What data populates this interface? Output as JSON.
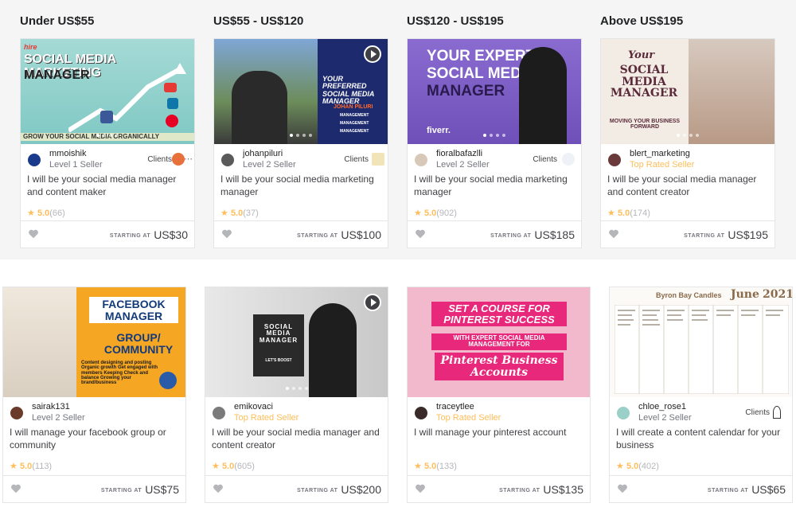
{
  "columns": [
    "Under US$55",
    "US$55 - US$120",
    "US$120 - US$195",
    "Above US$195"
  ],
  "starting_label": "STARTING AT",
  "cards": [
    {
      "seller": "mmoishik",
      "level": "Level 1 Seller",
      "clients": "Clients",
      "title": "I will be your social media manager and content maker",
      "rating": "5.0",
      "count": "(66)",
      "price": "US$30",
      "thumb_text": {
        "a": "hire",
        "b": "SOCIAL MEDIA MARKETING",
        "c": "MANAGER",
        "d": "GROW YOUR SOCIAL MEDIA ORGANICALLY"
      }
    },
    {
      "seller": "johanpiluri",
      "level": "Level 2 Seller",
      "clients": "Clients",
      "title": "I will be your social media marketing manager",
      "rating": "5.0",
      "count": "(37)",
      "price": "US$100",
      "thumb_text": {
        "a": "YOUR PREFERRED SOCIAL MEDIA MANAGER",
        "b": "JOHAN PILURI",
        "c": "MANAGEMENT",
        "d": "MANAGEMENT",
        "e": "MANAGEMENT"
      }
    },
    {
      "seller": "fioralbafazlli",
      "level": "Level 2 Seller",
      "clients": "Clients",
      "title": "I will be your social media marketing manager",
      "rating": "5.0",
      "count": "(902)",
      "price": "US$185",
      "thumb_text": {
        "a": "YOUR EXPERT",
        "b": "SOCIAL MEDIA",
        "c": "MANAGER",
        "d": "fiverr."
      }
    },
    {
      "seller": "blert_marketing",
      "level": "Top Rated Seller",
      "title": "I will be your social media manager and content creator",
      "rating": "5.0",
      "count": "(174)",
      "price": "US$195",
      "thumb_text": {
        "a": "Your",
        "b": "SOCIAL MEDIA MANAGER",
        "c": "MOVING YOUR BUSINESS FORWARD"
      }
    },
    {
      "seller": "sairak131",
      "level": "Level 2 Seller",
      "title": "I will manage your facebook group or community",
      "rating": "5.0",
      "count": "(113)",
      "price": "US$75",
      "thumb_text": {
        "a": "FACEBOOK MANAGER",
        "b": "GROUP/ COMMUNITY",
        "c": "Content designing and posting Organic growth Get engaged with members Keeping Check and balance Growing your brand/business"
      }
    },
    {
      "seller": "emikovaci",
      "level": "Top Rated Seller",
      "title": "I will be your social media manager and content creator",
      "rating": "5.0",
      "count": "(605)",
      "price": "US$200",
      "thumb_text": {
        "a": "SOCIAL MEDIA MANAGER",
        "b": "LET'S BOOST"
      }
    },
    {
      "seller": "traceytlee",
      "level": "Top Rated Seller",
      "title": "I will manage your pinterest account",
      "rating": "5.0",
      "count": "(133)",
      "price": "US$135",
      "thumb_text": {
        "a": "SET A COURSE FOR PINTEREST SUCCESS",
        "b": "WITH EXPERT SOCIAL MEDIA MANAGEMENT FOR",
        "c": "Pinterest Business Accounts"
      }
    },
    {
      "seller": "chloe_rose1",
      "level": "Level 2 Seller",
      "clients": "Clients",
      "title": "I will create a content calendar for your business",
      "rating": "5.0",
      "count": "(402)",
      "price": "US$65",
      "thumb_text": {
        "a": "Byron Bay Candles",
        "b": "June",
        "c": "2021"
      }
    }
  ],
  "colors": {
    "accent_star": "#ffbe5b",
    "text": "#404145",
    "muted": "#74767e"
  }
}
